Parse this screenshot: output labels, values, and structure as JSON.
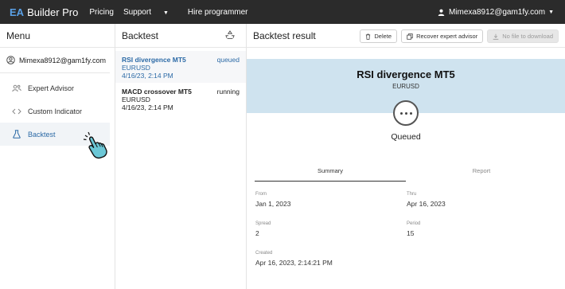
{
  "topbar": {
    "brand_prefix": "EA",
    "brand_name": "Builder Pro",
    "nav": {
      "pricing": "Pricing",
      "support": "Support",
      "hire": "Hire programmer"
    },
    "user_email": "Mimexa8912@gam1fy.com"
  },
  "menu": {
    "title": "Menu",
    "user_email": "Mimexa8912@gam1fy.com",
    "items": [
      {
        "label": "Expert Advisor"
      },
      {
        "label": "Custom Indicator"
      },
      {
        "label": "Backtest"
      }
    ]
  },
  "backtest": {
    "title": "Backtest",
    "items": [
      {
        "title": "RSI divergence MT5",
        "symbol": "EURUSD",
        "date": "4/16/23, 2:14 PM",
        "status": "queued"
      },
      {
        "title": "MACD crossover MT5",
        "symbol": "EURUSD",
        "date": "4/16/23, 2:14 PM",
        "status": "running"
      }
    ]
  },
  "result": {
    "title": "Backtest result",
    "buttons": {
      "delete": "Delete",
      "recover": "Recover expert advisor",
      "download": "No file to download"
    },
    "name": "RSI divergence MT5",
    "symbol": "EURUSD",
    "state": "Queued",
    "tabs": {
      "summary": "Summary",
      "report": "Report"
    },
    "fields": {
      "from_label": "From",
      "from_value": "Jan 1, 2023",
      "thru_label": "Thru",
      "thru_value": "Apr 16, 2023",
      "spread_label": "Spread",
      "spread_value": "2",
      "period_label": "Period",
      "period_value": "15",
      "created_label": "Created",
      "created_value": "Apr 16, 2023, 2:14:21 PM"
    }
  },
  "colors": {
    "topbar": "#2b2b2b",
    "accent": "#2c6aa6",
    "hero": "#cfe3ef"
  }
}
